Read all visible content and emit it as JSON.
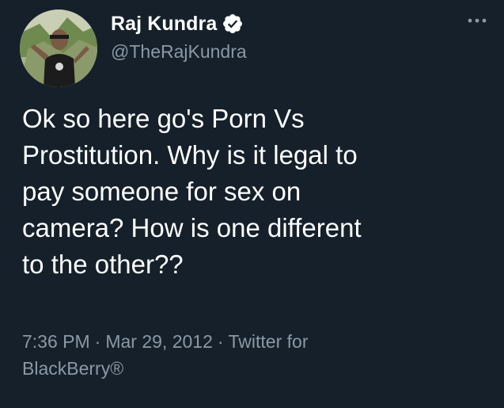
{
  "author": {
    "display_name": "Raj Kundra",
    "handle": "@TheRajKundra",
    "verified": true,
    "avatar_icon": "profile-photo"
  },
  "tweet": {
    "text": "Ok so here go's Porn Vs\nProstitution. Why is it legal to\npay someone for sex on\ncamera? How is one different\nto the other??",
    "time": "7:36 PM",
    "date": "Mar 29, 2012",
    "source_line1": "Twitter for",
    "source_line2": "BlackBerry®",
    "separator": "·"
  },
  "icons": {
    "verified": "verified-badge-icon",
    "more": "more-options-icon"
  },
  "colors": {
    "background": "#15202b",
    "primary_text": "#ffffff",
    "secondary_text": "#8b98a5"
  }
}
